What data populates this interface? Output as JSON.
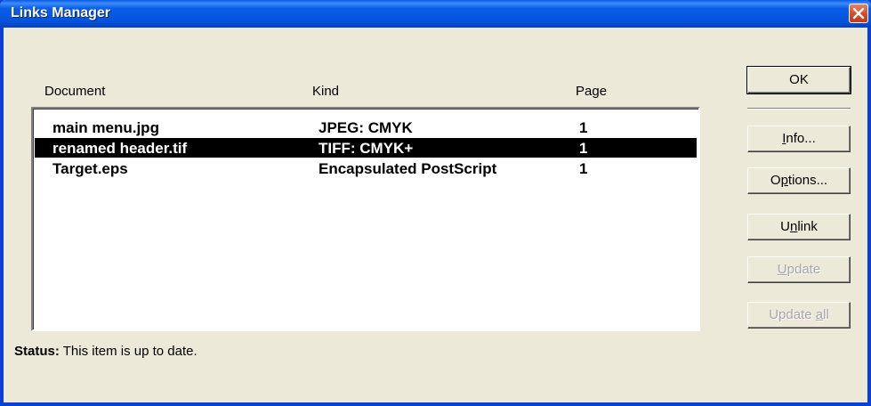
{
  "window": {
    "title": "Links Manager"
  },
  "columns": {
    "document": "Document",
    "kind": "Kind",
    "page": "Page"
  },
  "rows": [
    {
      "document": "main menu.jpg",
      "kind": "JPEG: CMYK",
      "page": "1",
      "selected": false
    },
    {
      "document": "renamed header.tif",
      "kind": "TIFF: CMYK+",
      "page": "1",
      "selected": true
    },
    {
      "document": "Target.eps",
      "kind": "Encapsulated PostScript",
      "page": "1",
      "selected": false
    }
  ],
  "status": {
    "label": "Status:",
    "text": "This item is up to date."
  },
  "buttons": {
    "ok": {
      "label": "OK",
      "enabled": true
    },
    "info": {
      "mnemonic": "I",
      "rest": "nfo...",
      "enabled": true
    },
    "options": {
      "pre": "O",
      "mnemonic": "p",
      "rest": "tions...",
      "enabled": true
    },
    "unlink": {
      "pre": "U",
      "mnemonic": "n",
      "rest": "link",
      "enabled": true
    },
    "update": {
      "mnemonic": "U",
      "rest": "pdate",
      "enabled": false
    },
    "update_all": {
      "pre": "Update ",
      "mnemonic": "a",
      "rest": "ll",
      "enabled": false
    }
  },
  "colors": {
    "titlebar": "#0553dc",
    "dialog_bg": "#ece9d8",
    "selection": "#000000",
    "disabled_text": "#a7a6aa"
  }
}
